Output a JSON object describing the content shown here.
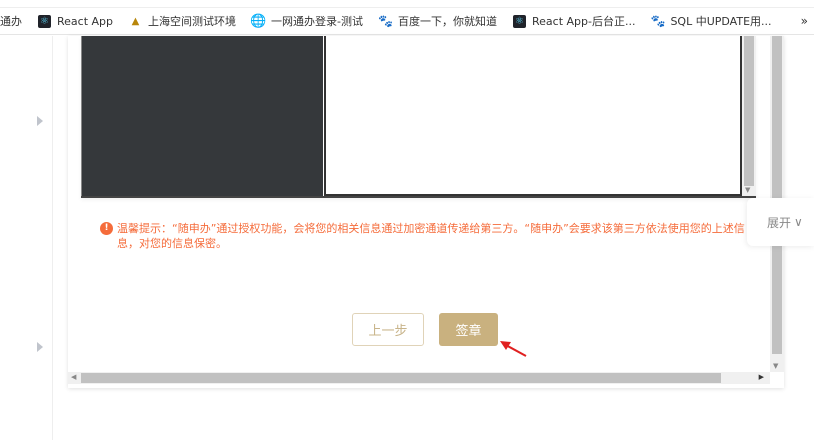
{
  "bookmarks": [
    {
      "label": "通办",
      "icon": "none"
    },
    {
      "label": "React App",
      "icon": "react-icon"
    },
    {
      "label": "上海空间测试环境",
      "icon": "triangle-icon"
    },
    {
      "label": "一网通办登录-测试",
      "icon": "globe-icon"
    },
    {
      "label": "百度一下，你就知道",
      "icon": "baidu-paw-icon"
    },
    {
      "label": "React App-后台正...",
      "icon": "react-icon"
    },
    {
      "label": "SQL 中UPDATE用...",
      "icon": "baidu-paw-icon"
    }
  ],
  "bookmarks_more": "»",
  "notice": {
    "text": "温馨提示：“随申办”通过授权功能，会将您的相关信息通过加密通道传递给第三方。“随申办”会要求该第三方依法使用您的上述信息，对您的信息保密。"
  },
  "buttons": {
    "prev": "上一步",
    "sign": "签章"
  },
  "expand": {
    "label": "展开"
  },
  "colors": {
    "accent": "#c9b17f",
    "warning": "#f56c3b"
  }
}
